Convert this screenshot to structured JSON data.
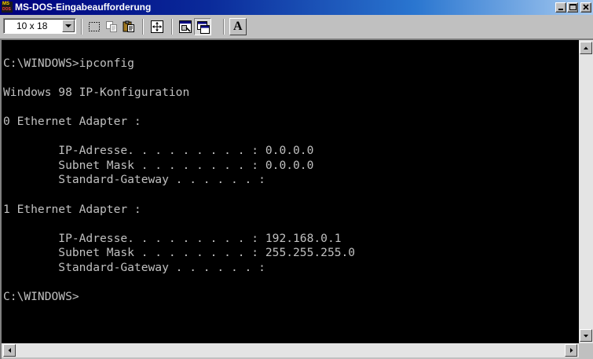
{
  "window": {
    "title": "MS-DOS-Eingabeaufforderung",
    "icon_label_top": "MS",
    "icon_label_bottom": "DOS"
  },
  "toolbar": {
    "font_size_value": "10 x 18",
    "font_button_label": "A",
    "icons": [
      "mark-icon",
      "copy-icon",
      "paste-icon",
      "fullscreen-icon",
      "properties-icon",
      "background-icon"
    ]
  },
  "console": {
    "lines": [
      "",
      "C:\\WINDOWS>ipconfig",
      "",
      "Windows 98 IP-Konfiguration",
      "",
      "0 Ethernet Adapter :",
      "",
      "        IP-Adresse. . . . . . . . . : 0.0.0.0",
      "        Subnet Mask . . . . . . . . : 0.0.0.0",
      "        Standard-Gateway . . . . . . :",
      "",
      "1 Ethernet Adapter :",
      "",
      "        IP-Adresse. . . . . . . . . : 192.168.0.1",
      "        Subnet Mask . . . . . . . . : 255.255.255.0",
      "        Standard-Gateway . . . . . . :",
      "",
      "C:\\WINDOWS>"
    ]
  },
  "colors": {
    "console_background": "#000000",
    "console_text": "#c0c0c0",
    "titlebar_start": "#00007c",
    "titlebar_end": "#a6caf0",
    "chrome": "#c0c0c0"
  }
}
